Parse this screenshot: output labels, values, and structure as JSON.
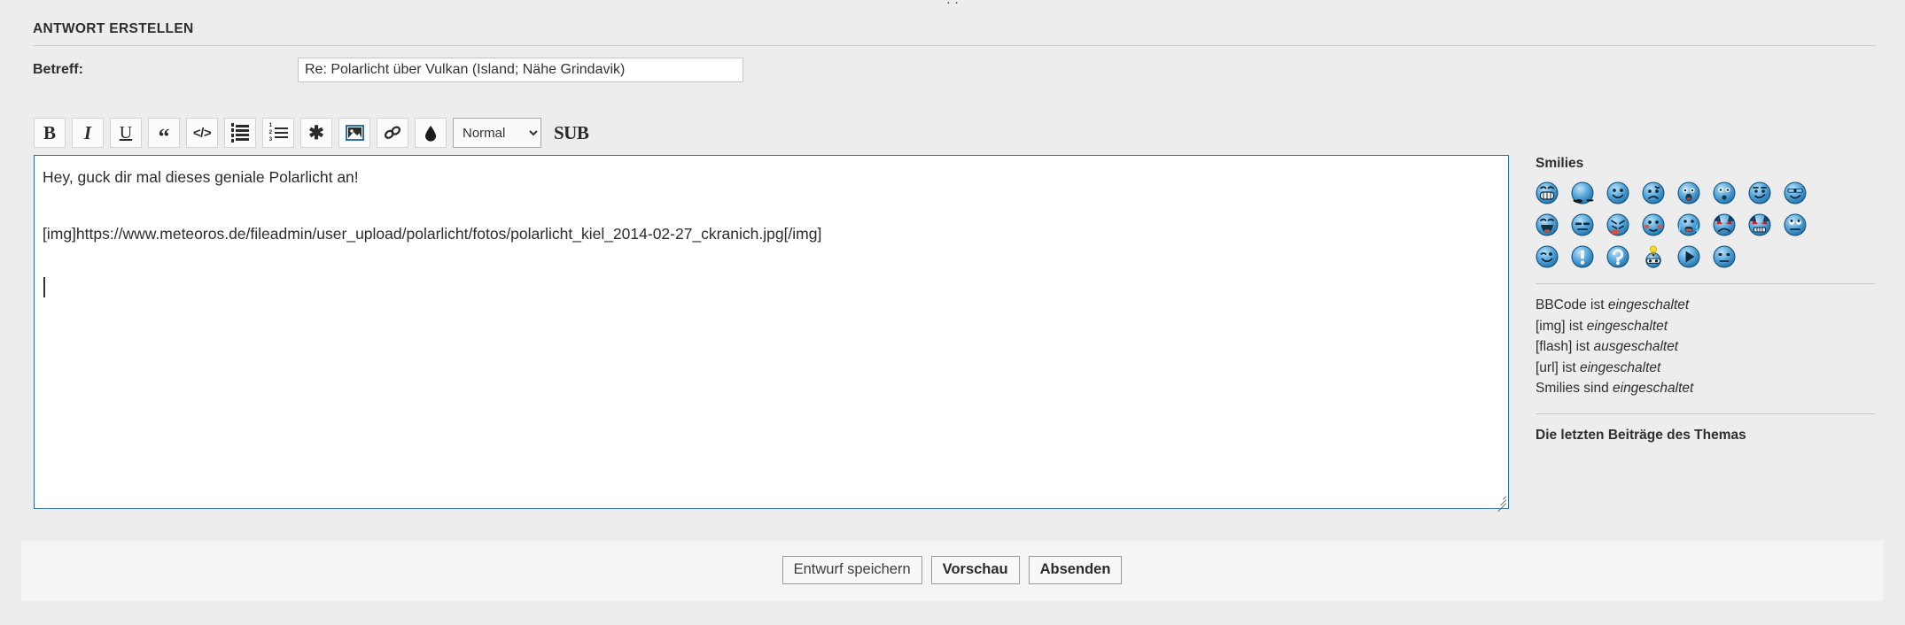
{
  "top_sliver": {
    "cut_text": "·                                              ·"
  },
  "form": {
    "heading": "ANTWORT ERSTELLEN",
    "subject": {
      "label": "Betreff:",
      "value": "Re: Polarlicht über Vulkan (Island; Nähe Grindavik)",
      "placeholder": ""
    },
    "toolbar": {
      "bold": "B",
      "italic": "I",
      "underline": "U",
      "quote": "“",
      "code": "</>",
      "unordered_list": "list-unordered-icon",
      "ordered_list": "list-ordered-icon",
      "asterisk": "✱",
      "image": "image-icon",
      "link": "link-icon",
      "color": "droplet-icon",
      "font_size_selected": "Normal",
      "font_size_options": [
        "Normal"
      ],
      "sub": "SUB"
    },
    "message": {
      "body": "Hey, guck dir mal dieses geniale Polarlicht an!\n\n[img]https://www.meteoros.de/fileadmin/user_upload/polarlicht/fotos/polarlicht_kiel_2014-02-27_ckranich.jpg[/img]\n"
    }
  },
  "sidebar": {
    "smilies_title": "Smilies",
    "smilies": [
      [
        {
          "name": "smiley-grin",
          "glyph": "grin"
        },
        {
          "name": "smiley-rolleyes",
          "glyph": "blank"
        },
        {
          "name": "smiley-smile",
          "glyph": "smile"
        },
        {
          "name": "smiley-sad",
          "glyph": "sad"
        },
        {
          "name": "smiley-shocked",
          "glyph": "shocked"
        },
        {
          "name": "smiley-surprised",
          "glyph": "surprised"
        },
        {
          "name": "smiley-wink-side",
          "glyph": "winkside"
        },
        {
          "name": "smiley-cool",
          "glyph": "cool"
        }
      ],
      [
        {
          "name": "smiley-laugh",
          "glyph": "laugh"
        },
        {
          "name": "smiley-neutral",
          "glyph": "neutral"
        },
        {
          "name": "smiley-tongue",
          "glyph": "tongue"
        },
        {
          "name": "smiley-blush",
          "glyph": "blush"
        },
        {
          "name": "smiley-cry",
          "glyph": "cry"
        },
        {
          "name": "smiley-evil",
          "glyph": "evil"
        },
        {
          "name": "smiley-twisted",
          "glyph": "twisted"
        },
        {
          "name": "smiley-rolling",
          "glyph": "rolling"
        }
      ],
      [
        {
          "name": "smiley-wink",
          "glyph": "wink"
        },
        {
          "name": "smiley-exclaim",
          "glyph": "exclaim"
        },
        {
          "name": "smiley-question",
          "glyph": "question"
        },
        {
          "name": "smiley-idea",
          "glyph": "idea"
        },
        {
          "name": "smiley-arrow",
          "glyph": "arrow"
        },
        {
          "name": "smiley-confused",
          "glyph": "confused"
        }
      ]
    ],
    "bbcode_status": [
      {
        "label": "BBCode ist",
        "value": "eingeschaltet"
      },
      {
        "label": "[img] ist",
        "value": "eingeschaltet"
      },
      {
        "label": "[flash] ist",
        "value": "ausgeschaltet"
      },
      {
        "label": "[url] ist",
        "value": "eingeschaltet"
      },
      {
        "label": "Smilies sind",
        "value": "eingeschaltet"
      }
    ],
    "recent_posts_title": "Die letzten Beiträge des Themas"
  },
  "footer": {
    "save_draft": "Entwurf speichern",
    "preview": "Vorschau",
    "submit": "Absenden"
  },
  "colors": {
    "page_bg": "#ededed",
    "panel_bg": "#f5f5f5",
    "textarea_border": "#2d6da3",
    "rule": "#cfcfcf",
    "text": "#2e2e2e"
  }
}
